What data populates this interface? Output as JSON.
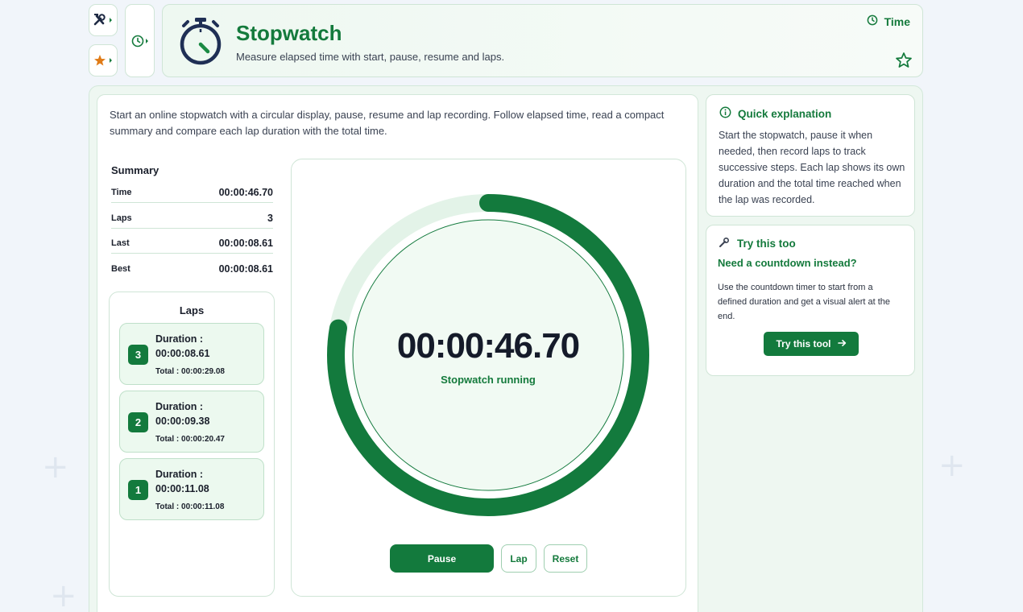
{
  "rail": {
    "tools_icon": "tools-icon",
    "favorites_icon": "star-icon",
    "history_icon": "clock-icon"
  },
  "header": {
    "title": "Stopwatch",
    "subtitle": "Measure elapsed time with start, pause, resume and laps.",
    "category": "Time",
    "favorite_icon": "star-outline-icon"
  },
  "intro": "Start an online stopwatch with a circular display, pause, resume and lap recording. Follow elapsed time, read a compact summary and compare each lap duration with the total time.",
  "summary": {
    "title": "Summary",
    "rows": [
      {
        "label": "Time",
        "value": "00:00:46.70"
      },
      {
        "label": "Laps",
        "value": "3"
      },
      {
        "label": "Last",
        "value": "00:00:08.61"
      },
      {
        "label": "Best",
        "value": "00:00:08.61"
      }
    ]
  },
  "laps": {
    "title": "Laps",
    "items": [
      {
        "number": "3",
        "duration_label": "Duration :",
        "duration": "00:00:08.61",
        "total": "Total : 00:00:29.08"
      },
      {
        "number": "2",
        "duration_label": "Duration :",
        "duration": "00:00:09.38",
        "total": "Total : 00:00:20.47"
      },
      {
        "number": "1",
        "duration_label": "Duration :",
        "duration": "00:00:11.08",
        "total": "Total : 00:00:11.08"
      }
    ]
  },
  "timer": {
    "display": "00:00:46.70",
    "status": "Stopwatch running",
    "progress": 0.778,
    "buttons": {
      "pause": "Pause",
      "lap": "Lap",
      "reset": "Reset"
    }
  },
  "quick": {
    "title": "Quick explanation",
    "text": "Start the stopwatch, pause it when needed, then record laps to track successive steps. Each lap shows its own duration and the total time reached when the lap was recorded."
  },
  "try": {
    "title": "Try this too",
    "subtitle": "Need a countdown instead?",
    "text": "Use the countdown timer to start from a defined duration and get a visual alert at the end.",
    "button": "Try this tool"
  },
  "colors": {
    "accent": "#137a3d",
    "accent_light": "#ecf9ef",
    "ring_track": "#e3f3e8",
    "favorites_orange": "#e07b17"
  }
}
